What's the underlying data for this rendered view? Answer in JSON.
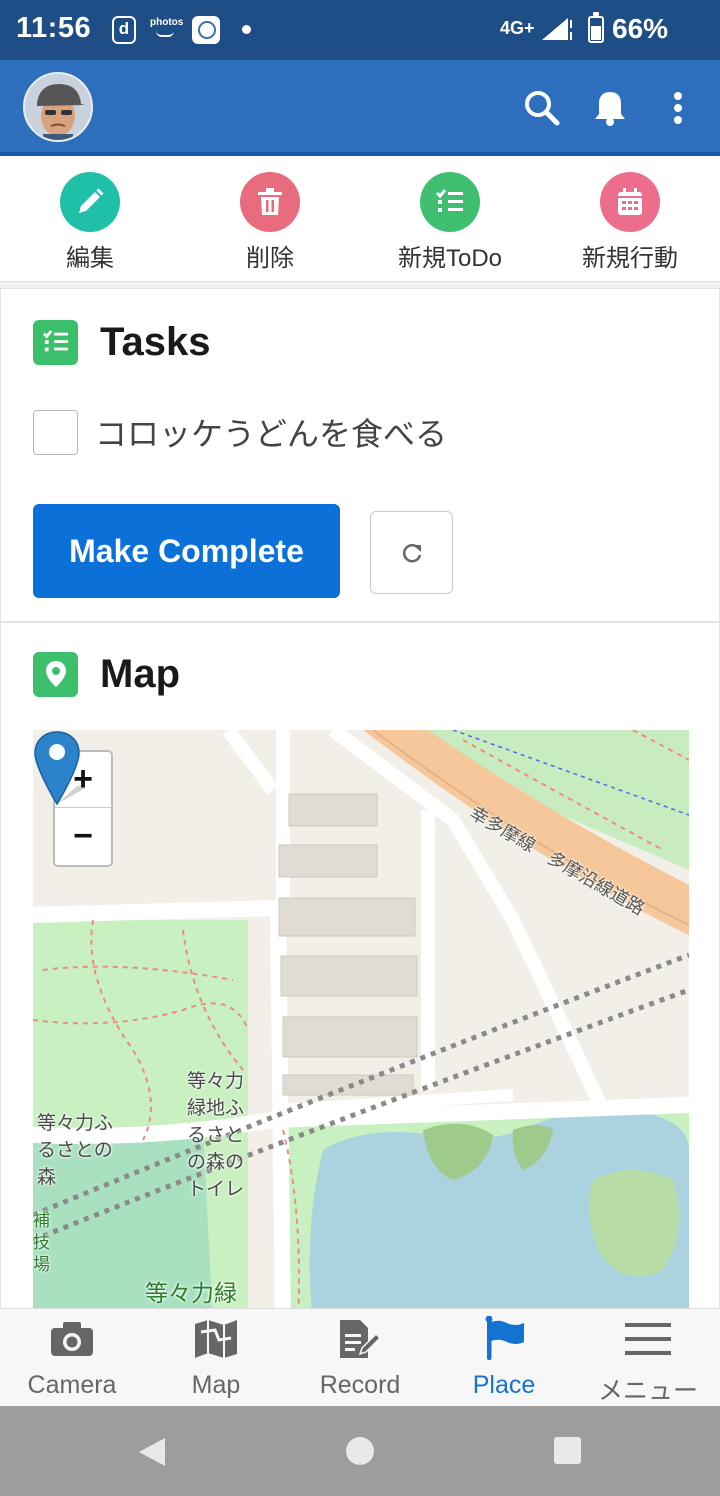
{
  "status_bar": {
    "time": "11:56",
    "d_icon_letter": "d",
    "photos_text": "photos",
    "network": "4G+",
    "battery_percent": "66%"
  },
  "app_bar": {
    "avatar": "user-avatar",
    "icons": [
      "search-icon",
      "bell-icon",
      "more-vert-icon"
    ],
    "color": "#2d6fbd"
  },
  "actions": [
    {
      "label": "編集",
      "icon": "pencil-icon",
      "color": "#1fbfa8"
    },
    {
      "label": "削除",
      "icon": "trash-icon",
      "color": "#e96b7e"
    },
    {
      "label": "新規ToDo",
      "icon": "checklist-icon",
      "color": "#41bf71"
    },
    {
      "label": "新規行動",
      "icon": "calendar-icon",
      "color": "#ec6d8c"
    }
  ],
  "tasks": {
    "title": "Tasks",
    "items": [
      {
        "text": "コロッケうどんを食べる",
        "checked": false
      }
    ],
    "complete_button": "Make Complete",
    "refresh_icon": "refresh-icon"
  },
  "map": {
    "title": "Map",
    "zoom_in": "+",
    "zoom_out": "−",
    "labels": {
      "rail": "幸多摩線　多摩沿線道路",
      "park_forest": "等々力ふるさとの森",
      "toilet": "等々力緑地ふるさとの森のトイレ",
      "park_bottom": "等々力緑",
      "field": "補技場"
    }
  },
  "bottom_nav": {
    "items": [
      {
        "label": "Camera",
        "icon": "camera-icon",
        "active": false
      },
      {
        "label": "Map",
        "icon": "map-icon",
        "active": false
      },
      {
        "label": "Record",
        "icon": "record-icon",
        "active": false
      },
      {
        "label": "Place",
        "icon": "flag-icon",
        "active": true
      },
      {
        "label": "メニュー",
        "icon": "menu-icon",
        "active": false
      }
    ],
    "active_color": "#1373d0"
  },
  "system_nav": [
    "back-icon",
    "home-icon",
    "recents-icon"
  ]
}
